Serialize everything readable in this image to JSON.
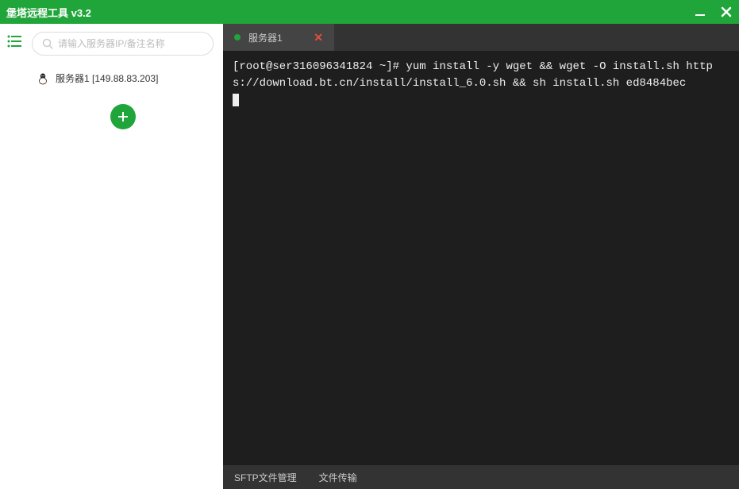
{
  "titlebar": {
    "title": "堡塔远程工具 v3.2"
  },
  "sidebar": {
    "search_placeholder": "请输入服务器IP/备注名称",
    "servers": [
      {
        "label": "服务器1 [149.88.83.203]"
      }
    ]
  },
  "tabs": [
    {
      "label": "服务器1",
      "status": "connected"
    }
  ],
  "terminal": {
    "content": "[root@ser316096341824 ~]# yum install -y wget && wget -O install.sh https://download.bt.cn/install/install_6.0.sh && sh install.sh ed8484bec"
  },
  "bottom": {
    "sftp": "SFTP文件管理",
    "transfer": "文件传输"
  },
  "colors": {
    "accent": "#20a53a",
    "terminal_bg": "#1e1e1e",
    "tab_bg": "#444444",
    "tabbar_bg": "#333333"
  }
}
